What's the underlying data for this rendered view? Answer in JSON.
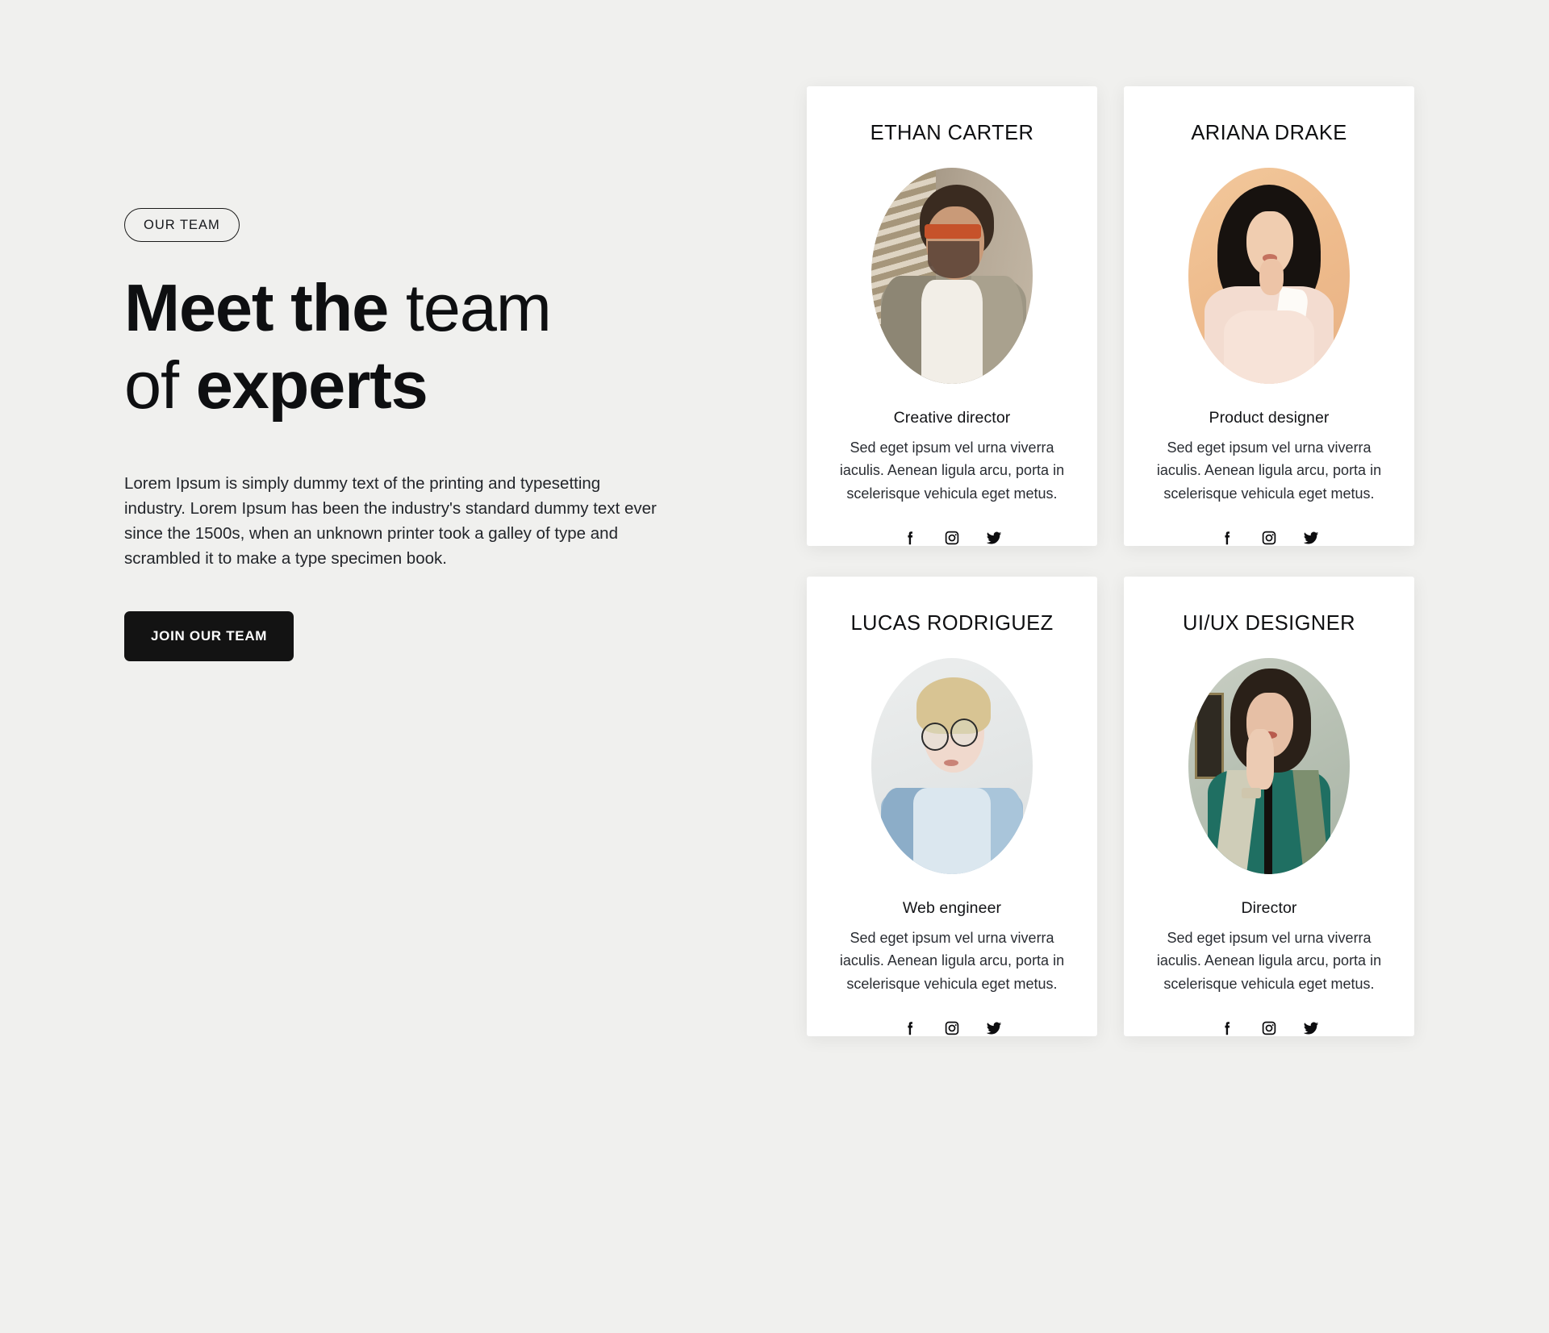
{
  "intro": {
    "badge": "OUR TEAM",
    "headline_line1_strong": "Meet the",
    "headline_line1_light": " team",
    "headline_line2_light": "of ",
    "headline_line2_strong": "experts",
    "paragraph": "Lorem Ipsum is simply dummy text of the printing and typesetting industry. Lorem Ipsum has been the industry's standard dummy text ever since the 1500s, when an unknown printer took a galley of type and scrambled it to make a type specimen book.",
    "cta_label": "JOIN OUR TEAM"
  },
  "colors": {
    "page_background": "#f0f0ee",
    "card_background": "#ffffff",
    "text_primary": "#0e0f11",
    "text_body": "#22252a",
    "cta_background": "#131313",
    "cta_text": "#ffffff"
  },
  "socials": [
    {
      "name": "facebook-icon",
      "label": "Facebook"
    },
    {
      "name": "instagram-icon",
      "label": "Instagram"
    },
    {
      "name": "twitter-icon",
      "label": "Twitter"
    }
  ],
  "cards": [
    {
      "name": "ETHAN CARTER",
      "role": "Creative director",
      "description": "Sed eget ipsum vel urna viverra iaculis. Aenean ligula arcu, porta in scelerisque vehicula eget metus."
    },
    {
      "name": "ARIANA DRAKE",
      "role": "Product designer",
      "description": "Sed eget ipsum vel urna viverra iaculis. Aenean ligula arcu, porta in scelerisque vehicula eget metus."
    },
    {
      "name": "LUCAS RODRIGUEZ",
      "role": "Web engineer",
      "description": "Sed eget ipsum vel urna viverra iaculis. Aenean ligula arcu, porta in scelerisque vehicula eget metus."
    },
    {
      "name": "UI/UX DESIGNER",
      "role": "Director",
      "description": "Sed eget ipsum vel urna viverra iaculis. Aenean ligula arcu, porta in scelerisque vehicula eget metus."
    }
  ]
}
